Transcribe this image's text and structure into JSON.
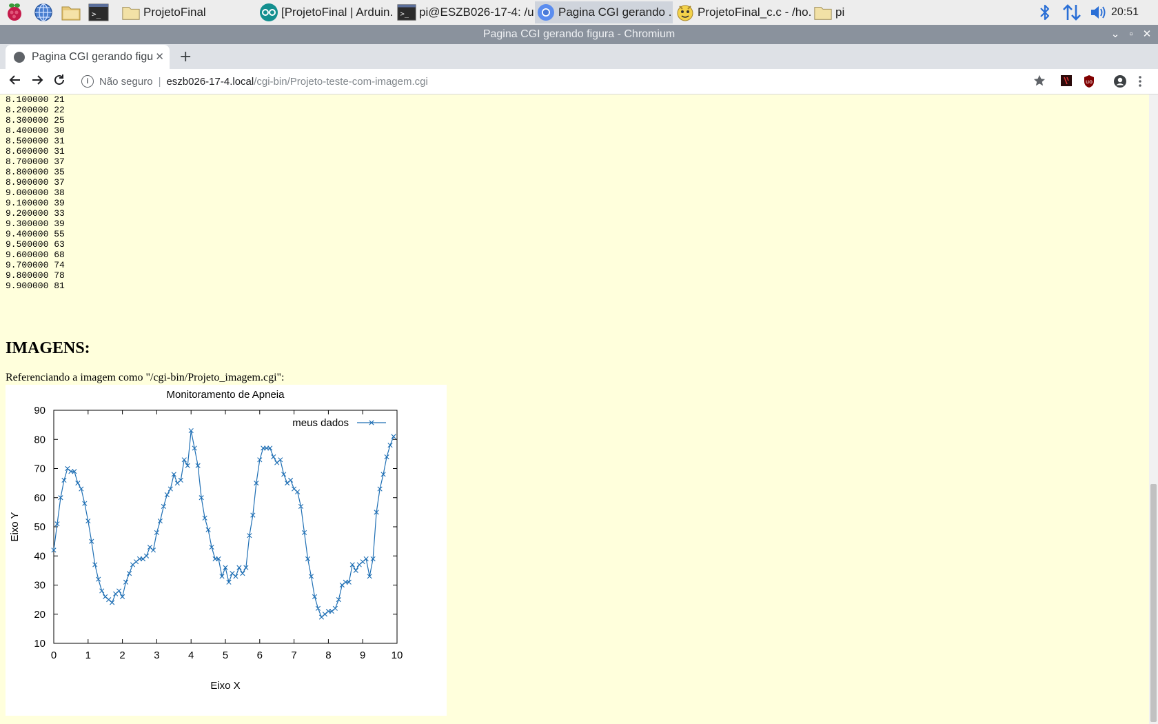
{
  "taskbar": {
    "launchers": [
      {
        "name": "raspberry-menu-icon"
      },
      {
        "name": "web-browser-icon"
      },
      {
        "name": "file-manager-icon"
      },
      {
        "name": "terminal-icon"
      }
    ],
    "windows": [
      {
        "label": "ProjetoFinal",
        "icon": "folder-icon",
        "active": false
      },
      {
        "label": "[ProjetoFinal | Arduin...",
        "icon": "arduino-icon",
        "active": false
      },
      {
        "label": "pi@ESZB026-17-4: /u...",
        "icon": "terminal-icon",
        "active": false
      },
      {
        "label": "Pagina CGI gerando ...",
        "icon": "chromium-icon",
        "active": true
      },
      {
        "label": "ProjetoFinal_c.c - /ho...",
        "icon": "geany-icon",
        "active": false
      },
      {
        "label": "pi",
        "icon": "folder-icon",
        "active": false
      }
    ],
    "clock": "20:51"
  },
  "window": {
    "title": "Pagina CGI gerando figura - Chromium"
  },
  "browser": {
    "tab_title": "Pagina CGI gerando figura",
    "security_label": "Não seguro",
    "url_host": "eszb026-17-4.local",
    "url_path": "/cgi-bin/Projeto-teste-com-imagem.cgi"
  },
  "page": {
    "data_lines": [
      "8.100000 21",
      "8.200000 22",
      "8.300000 25",
      "8.400000 30",
      "8.500000 31",
      "8.600000 31",
      "8.700000 37",
      "8.800000 35",
      "8.900000 37",
      "9.000000 38",
      "9.100000 39",
      "9.200000 33",
      "9.300000 39",
      "9.400000 55",
      "9.500000 63",
      "9.600000 68",
      "9.700000 74",
      "9.800000 78",
      "9.900000 81"
    ],
    "heading": "IMAGENS:",
    "reference_text": "Referenciando a imagem como \"/cgi-bin/Projeto_imagem.cgi\":"
  },
  "chart_data": {
    "type": "line",
    "title": "Monitoramento de Apneia",
    "xlabel": "Eixo X",
    "ylabel": "Eixo Y",
    "xlim": [
      0,
      10
    ],
    "ylim": [
      10,
      90
    ],
    "x_ticks": [
      "0",
      "1",
      "2",
      "3",
      "4",
      "5",
      "6",
      "7",
      "8",
      "9",
      "10"
    ],
    "y_ticks": [
      "10",
      "20",
      "30",
      "40",
      "50",
      "60",
      "70",
      "80",
      "90"
    ],
    "grid": false,
    "legend_position": "top-right",
    "color": "#1f6fb4",
    "marker": "x",
    "series": [
      {
        "name": "meus dados",
        "x": [
          0,
          0.1,
          0.2,
          0.3,
          0.4,
          0.5,
          0.6,
          0.7,
          0.8,
          0.9,
          1,
          1.1,
          1.2,
          1.3,
          1.4,
          1.5,
          1.6,
          1.7,
          1.8,
          1.9,
          2,
          2.1,
          2.2,
          2.3,
          2.4,
          2.5,
          2.6,
          2.7,
          2.8,
          2.9,
          3,
          3.1,
          3.2,
          3.3,
          3.4,
          3.5,
          3.6,
          3.7,
          3.8,
          3.9,
          4,
          4.1,
          4.2,
          4.3,
          4.4,
          4.5,
          4.6,
          4.7,
          4.8,
          4.9,
          5,
          5.1,
          5.2,
          5.3,
          5.4,
          5.5,
          5.6,
          5.7,
          5.8,
          5.9,
          6,
          6.1,
          6.2,
          6.3,
          6.4,
          6.5,
          6.6,
          6.7,
          6.8,
          6.9,
          7,
          7.1,
          7.2,
          7.3,
          7.4,
          7.5,
          7.6,
          7.7,
          7.8,
          7.9,
          8,
          8.1,
          8.2,
          8.3,
          8.4,
          8.5,
          8.6,
          8.7,
          8.8,
          8.9,
          9,
          9.1,
          9.2,
          9.3,
          9.4,
          9.5,
          9.6,
          9.7,
          9.8,
          9.9
        ],
        "values": [
          42,
          51,
          60,
          66,
          70,
          69,
          69,
          65,
          63,
          58,
          52,
          45,
          37,
          32,
          28,
          26,
          25,
          24,
          27,
          28,
          26,
          31,
          34,
          37,
          38,
          39,
          39,
          40,
          43,
          42,
          48,
          52,
          57,
          61,
          63,
          68,
          65,
          66,
          73,
          71,
          83,
          77,
          71,
          60,
          53,
          49,
          43,
          39,
          39,
          33,
          36,
          31,
          34,
          33,
          36,
          34,
          36,
          47,
          54,
          65,
          73,
          77,
          77,
          77,
          74,
          72,
          73,
          68,
          65,
          66,
          63,
          62,
          57,
          48,
          39,
          33,
          26,
          22,
          19,
          20,
          21,
          21,
          22,
          25,
          30,
          31,
          31,
          37,
          35,
          37,
          38,
          39,
          33,
          39,
          55,
          63,
          68,
          74,
          78,
          81
        ]
      }
    ]
  }
}
